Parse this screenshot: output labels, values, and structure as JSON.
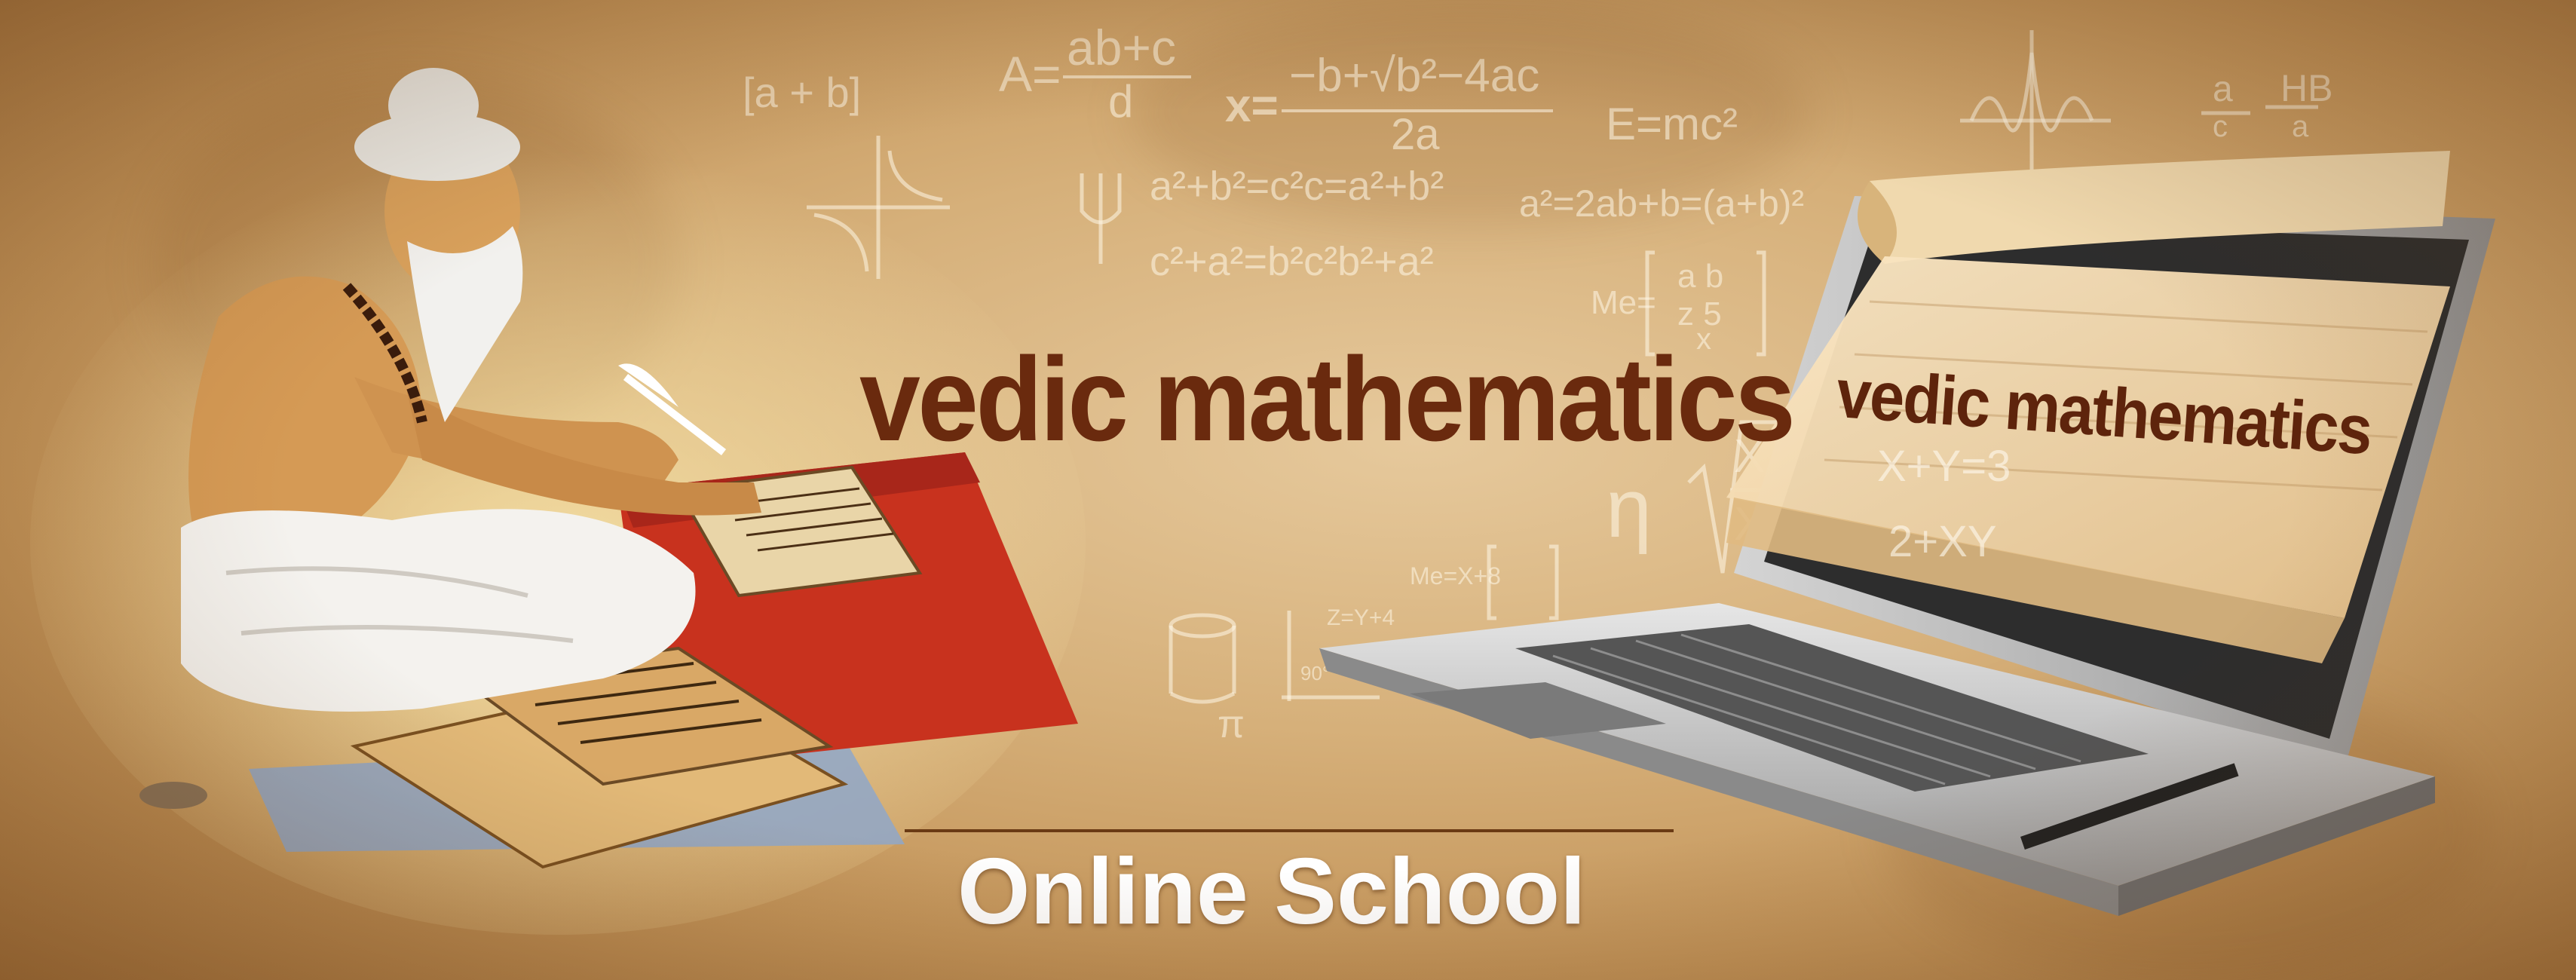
{
  "banner": {
    "title": "vedic mathematics",
    "screen_title": "vedic mathematics",
    "subtitle": "Online School"
  },
  "formulas": {
    "f1": "[a + b]",
    "f2": "A=",
    "f3": "ab+c",
    "f4": "d",
    "f5": "x=",
    "f6": "−b+√b²−4ac",
    "f7": "2a",
    "f8": "E=mc²",
    "f9": "a²+b²=c²c=a²+b²",
    "f10": "c²+a²=b²c²b²+a²",
    "f11": "a²=2ab+b=(a+b)²",
    "f12": "Me=",
    "f13": "a  b",
    "f14": "z  5",
    "f15": "x",
    "f16": "η",
    "f17": "X",
    "f18": "=C",
    "f19": "X",
    "f20": "Me=X+8",
    "f21": "Z=Y+4",
    "f22": "π",
    "f23": "90°",
    "f24": "a",
    "f25": "c",
    "f26": "HB",
    "f27": "a",
    "f28": "X+Y=3",
    "f29": "2+XY"
  },
  "colors": {
    "parchment": "#d6b07a",
    "title": "#6a2a0e",
    "subtitle": "#ffffff",
    "laptop": "#b9b9b9"
  }
}
